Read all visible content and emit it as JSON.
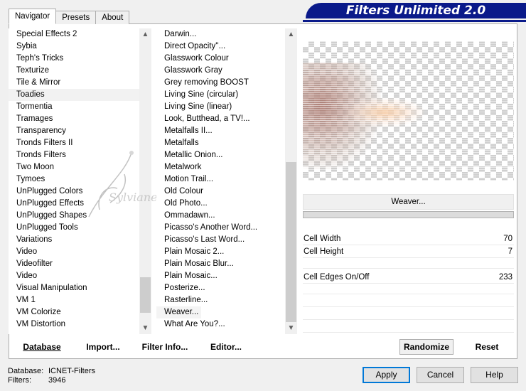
{
  "tabs": [
    {
      "label": "Navigator",
      "active": true
    },
    {
      "label": "Presets",
      "active": false
    },
    {
      "label": "About",
      "active": false
    }
  ],
  "banner": {
    "title": "Filters Unlimited 2.0"
  },
  "categories": {
    "selected": "Toadies",
    "items": [
      "Special Effects 2",
      "Sybia",
      "Teph's Tricks",
      "Texturize",
      "Tile & Mirror",
      "Toadies",
      "Tormentia",
      "Tramages",
      "Transparency",
      "Tronds Filters II",
      "Tronds Filters",
      "Two Moon",
      "Tymoes",
      "UnPlugged Colors",
      "UnPlugged Effects",
      "UnPlugged Shapes",
      "UnPlugged Tools",
      "Variations",
      "Video",
      "Videofilter",
      "Video",
      "Visual Manipulation",
      "VM 1",
      "VM Colorize",
      "VM Distortion"
    ]
  },
  "filters": {
    "selected": "Weaver...",
    "items": [
      "Darwin...",
      "Direct Opacity''...",
      "Glasswork Colour",
      "Glasswork Gray",
      "Grey removing BOOST",
      "Living Sine (circular)",
      "Living Sine (linear)",
      "Look, Butthead, a TV!...",
      "Metalfalls II...",
      "Metalfalls",
      "Metallic Onion...",
      "Metalwork",
      "Motion Trail...",
      "Old Colour",
      "Old Photo...",
      "Ommadawn...",
      "Picasso's Another Word...",
      "Picasso's Last Word...",
      "Plain Mosaic 2...",
      "Plain Mosaic Blur...",
      "Plain Mosaic...",
      "Posterize...",
      "Rasterline...",
      "Weaver...",
      "What Are You?..."
    ]
  },
  "watermark": {
    "text": "Sylviane"
  },
  "preview": {
    "filter_name": "Weaver..."
  },
  "params": [
    {
      "label": "Cell Width",
      "value": "70"
    },
    {
      "label": "Cell Height",
      "value": "7"
    },
    {
      "label": "Cell Edges On/Off",
      "value": "233"
    }
  ],
  "toolbar": {
    "database": "Database",
    "import": "Import...",
    "filter_info": "Filter Info...",
    "editor": "Editor...",
    "randomize": "Randomize",
    "reset": "Reset"
  },
  "footer": {
    "database_label": "Database:",
    "database_value": "ICNET-Filters",
    "filters_label": "Filters:",
    "filters_value": "3946"
  },
  "buttons": {
    "apply": "Apply",
    "cancel": "Cancel",
    "help": "Help"
  },
  "colors": {
    "banner": "#0a1a8a",
    "accent": "#0078d7"
  }
}
